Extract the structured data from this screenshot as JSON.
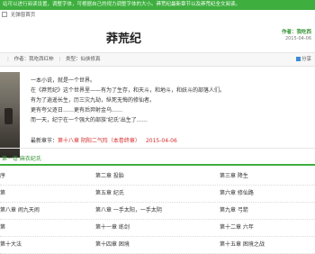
{
  "topbar": {
    "notice": "站可以进行阅读设置，调整字体，可根据自己的视力调整字体的大小。",
    "highlight": "莽荒纪最新章节以及莽荒纪全文阅读。"
  },
  "breadcrumb": {
    "site": "无弹窗首页"
  },
  "book": {
    "title": "莽荒纪",
    "author_top": "作者：我吃西",
    "author_top2": "2015-04-06",
    "meta_author": "作者：我吃西红柿",
    "meta_category": "类型：仙侠修真",
    "share": "分享"
  },
  "description": {
    "lines": [
      "一本小说，就是一个世界。",
      "在《莽荒纪》这个世界里——有为了生存，和天斗，和地斗，和妖斗的部落人们。",
      "有为了逍遥长生，历三灾九劫，纵死无悔的修仙者。",
      "更有夸父逐日……更有后羿射金乌……",
      "而一天，纪宁在一个强大的部族‘纪氏’出生了……"
    ]
  },
  "latest": {
    "label": "最新章节：",
    "chapter": "第十八章 阴阳二气阵（本卷终章）",
    "date": "2015-04-06"
  },
  "volume": {
    "title": "第一卷 麻衣纪氏"
  },
  "chapters": [
    [
      "序",
      "第二章 投胎",
      "第三章 降生"
    ],
    [
      "第",
      "第五章 纪氏",
      "第六章 修仙路"
    ],
    [
      "第八章 闹九天闹",
      "第八章 一手太阳，一手太阴",
      "第九章 弓箭"
    ],
    [
      "第",
      "第十一章 练剑",
      "第十二章 六年"
    ],
    [
      "第十大法",
      "第十四章 困境",
      "第十五章 困境之战"
    ]
  ]
}
